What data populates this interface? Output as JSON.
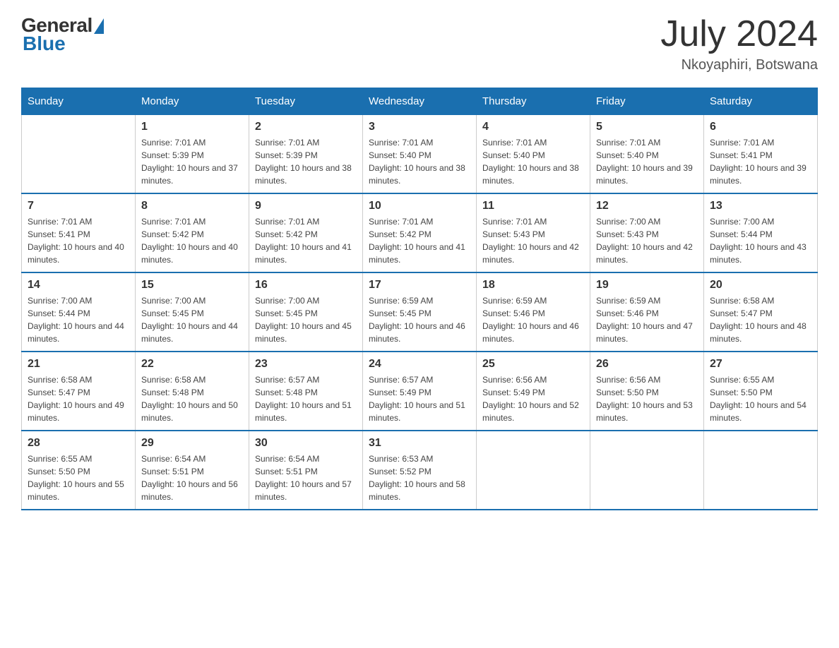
{
  "header": {
    "logo": {
      "general_text": "General",
      "blue_text": "Blue"
    },
    "title": "July 2024",
    "location": "Nkoyaphiri, Botswana"
  },
  "days_of_week": [
    "Sunday",
    "Monday",
    "Tuesday",
    "Wednesday",
    "Thursday",
    "Friday",
    "Saturday"
  ],
  "weeks": [
    [
      {
        "day": "",
        "sunrise": "",
        "sunset": "",
        "daylight": ""
      },
      {
        "day": "1",
        "sunrise": "Sunrise: 7:01 AM",
        "sunset": "Sunset: 5:39 PM",
        "daylight": "Daylight: 10 hours and 37 minutes."
      },
      {
        "day": "2",
        "sunrise": "Sunrise: 7:01 AM",
        "sunset": "Sunset: 5:39 PM",
        "daylight": "Daylight: 10 hours and 38 minutes."
      },
      {
        "day": "3",
        "sunrise": "Sunrise: 7:01 AM",
        "sunset": "Sunset: 5:40 PM",
        "daylight": "Daylight: 10 hours and 38 minutes."
      },
      {
        "day": "4",
        "sunrise": "Sunrise: 7:01 AM",
        "sunset": "Sunset: 5:40 PM",
        "daylight": "Daylight: 10 hours and 38 minutes."
      },
      {
        "day": "5",
        "sunrise": "Sunrise: 7:01 AM",
        "sunset": "Sunset: 5:40 PM",
        "daylight": "Daylight: 10 hours and 39 minutes."
      },
      {
        "day": "6",
        "sunrise": "Sunrise: 7:01 AM",
        "sunset": "Sunset: 5:41 PM",
        "daylight": "Daylight: 10 hours and 39 minutes."
      }
    ],
    [
      {
        "day": "7",
        "sunrise": "Sunrise: 7:01 AM",
        "sunset": "Sunset: 5:41 PM",
        "daylight": "Daylight: 10 hours and 40 minutes."
      },
      {
        "day": "8",
        "sunrise": "Sunrise: 7:01 AM",
        "sunset": "Sunset: 5:42 PM",
        "daylight": "Daylight: 10 hours and 40 minutes."
      },
      {
        "day": "9",
        "sunrise": "Sunrise: 7:01 AM",
        "sunset": "Sunset: 5:42 PM",
        "daylight": "Daylight: 10 hours and 41 minutes."
      },
      {
        "day": "10",
        "sunrise": "Sunrise: 7:01 AM",
        "sunset": "Sunset: 5:42 PM",
        "daylight": "Daylight: 10 hours and 41 minutes."
      },
      {
        "day": "11",
        "sunrise": "Sunrise: 7:01 AM",
        "sunset": "Sunset: 5:43 PM",
        "daylight": "Daylight: 10 hours and 42 minutes."
      },
      {
        "day": "12",
        "sunrise": "Sunrise: 7:00 AM",
        "sunset": "Sunset: 5:43 PM",
        "daylight": "Daylight: 10 hours and 42 minutes."
      },
      {
        "day": "13",
        "sunrise": "Sunrise: 7:00 AM",
        "sunset": "Sunset: 5:44 PM",
        "daylight": "Daylight: 10 hours and 43 minutes."
      }
    ],
    [
      {
        "day": "14",
        "sunrise": "Sunrise: 7:00 AM",
        "sunset": "Sunset: 5:44 PM",
        "daylight": "Daylight: 10 hours and 44 minutes."
      },
      {
        "day": "15",
        "sunrise": "Sunrise: 7:00 AM",
        "sunset": "Sunset: 5:45 PM",
        "daylight": "Daylight: 10 hours and 44 minutes."
      },
      {
        "day": "16",
        "sunrise": "Sunrise: 7:00 AM",
        "sunset": "Sunset: 5:45 PM",
        "daylight": "Daylight: 10 hours and 45 minutes."
      },
      {
        "day": "17",
        "sunrise": "Sunrise: 6:59 AM",
        "sunset": "Sunset: 5:45 PM",
        "daylight": "Daylight: 10 hours and 46 minutes."
      },
      {
        "day": "18",
        "sunrise": "Sunrise: 6:59 AM",
        "sunset": "Sunset: 5:46 PM",
        "daylight": "Daylight: 10 hours and 46 minutes."
      },
      {
        "day": "19",
        "sunrise": "Sunrise: 6:59 AM",
        "sunset": "Sunset: 5:46 PM",
        "daylight": "Daylight: 10 hours and 47 minutes."
      },
      {
        "day": "20",
        "sunrise": "Sunrise: 6:58 AM",
        "sunset": "Sunset: 5:47 PM",
        "daylight": "Daylight: 10 hours and 48 minutes."
      }
    ],
    [
      {
        "day": "21",
        "sunrise": "Sunrise: 6:58 AM",
        "sunset": "Sunset: 5:47 PM",
        "daylight": "Daylight: 10 hours and 49 minutes."
      },
      {
        "day": "22",
        "sunrise": "Sunrise: 6:58 AM",
        "sunset": "Sunset: 5:48 PM",
        "daylight": "Daylight: 10 hours and 50 minutes."
      },
      {
        "day": "23",
        "sunrise": "Sunrise: 6:57 AM",
        "sunset": "Sunset: 5:48 PM",
        "daylight": "Daylight: 10 hours and 51 minutes."
      },
      {
        "day": "24",
        "sunrise": "Sunrise: 6:57 AM",
        "sunset": "Sunset: 5:49 PM",
        "daylight": "Daylight: 10 hours and 51 minutes."
      },
      {
        "day": "25",
        "sunrise": "Sunrise: 6:56 AM",
        "sunset": "Sunset: 5:49 PM",
        "daylight": "Daylight: 10 hours and 52 minutes."
      },
      {
        "day": "26",
        "sunrise": "Sunrise: 6:56 AM",
        "sunset": "Sunset: 5:50 PM",
        "daylight": "Daylight: 10 hours and 53 minutes."
      },
      {
        "day": "27",
        "sunrise": "Sunrise: 6:55 AM",
        "sunset": "Sunset: 5:50 PM",
        "daylight": "Daylight: 10 hours and 54 minutes."
      }
    ],
    [
      {
        "day": "28",
        "sunrise": "Sunrise: 6:55 AM",
        "sunset": "Sunset: 5:50 PM",
        "daylight": "Daylight: 10 hours and 55 minutes."
      },
      {
        "day": "29",
        "sunrise": "Sunrise: 6:54 AM",
        "sunset": "Sunset: 5:51 PM",
        "daylight": "Daylight: 10 hours and 56 minutes."
      },
      {
        "day": "30",
        "sunrise": "Sunrise: 6:54 AM",
        "sunset": "Sunset: 5:51 PM",
        "daylight": "Daylight: 10 hours and 57 minutes."
      },
      {
        "day": "31",
        "sunrise": "Sunrise: 6:53 AM",
        "sunset": "Sunset: 5:52 PM",
        "daylight": "Daylight: 10 hours and 58 minutes."
      },
      {
        "day": "",
        "sunrise": "",
        "sunset": "",
        "daylight": ""
      },
      {
        "day": "",
        "sunrise": "",
        "sunset": "",
        "daylight": ""
      },
      {
        "day": "",
        "sunrise": "",
        "sunset": "",
        "daylight": ""
      }
    ]
  ]
}
